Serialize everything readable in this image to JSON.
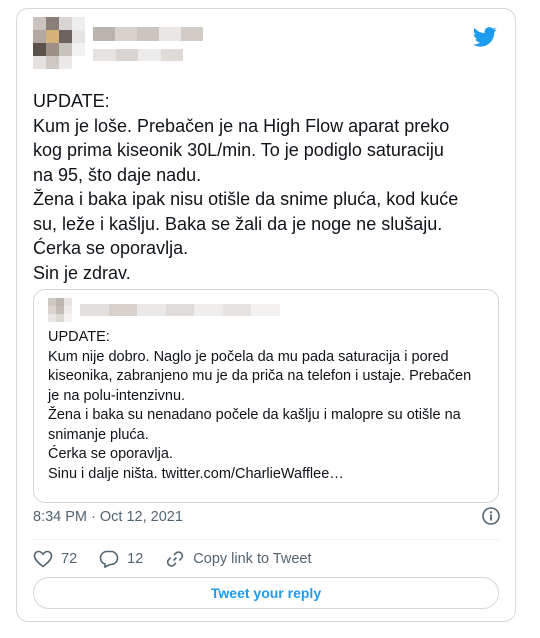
{
  "tweet": {
    "text": "UPDATE:\nKum je loše. Prebačen je na High Flow aparat preko\nkog prima kiseonik 30L/min. To je podiglo saturaciju\nna 95, što daje nadu.\nŽena i baka ipak nisu otišle da snime pluća, kod kuće\nsu, leže i kašlju. Baka se žali da je noge ne slušaju.\nĆerka se oporavlja.\nSin je zdrav.",
    "timestamp": "8:34 PM · Oct 12, 2021",
    "likes": "72",
    "replies": "12",
    "copy_link_label": "Copy link to Tweet",
    "reply_button_label": "Tweet your reply"
  },
  "quoted_tweet": {
    "text": "UPDATE:\nKum nije dobro. Naglo je počela da mu pada saturacija i pored\nkiseonika, zabranjeno mu je da priča na telefon i ustaje. Prebačen\nje na polu-intenzivnu.\nŽena i baka su nenadano počele da kašlju i malopre su otišle na\nsnimanje pluća.\nĆerka se oporavlja.\nSinu i dalje ništa. twitter.com/CharlieWafflee…"
  },
  "icons": {
    "brand": "twitter-bird-icon",
    "info": "info-icon",
    "like": "heart-icon",
    "reply": "reply-bubble-icon",
    "link": "link-icon"
  },
  "colors": {
    "brand": "#1d9bf0",
    "secondary_text": "#536471",
    "border": "#cfd9de"
  }
}
